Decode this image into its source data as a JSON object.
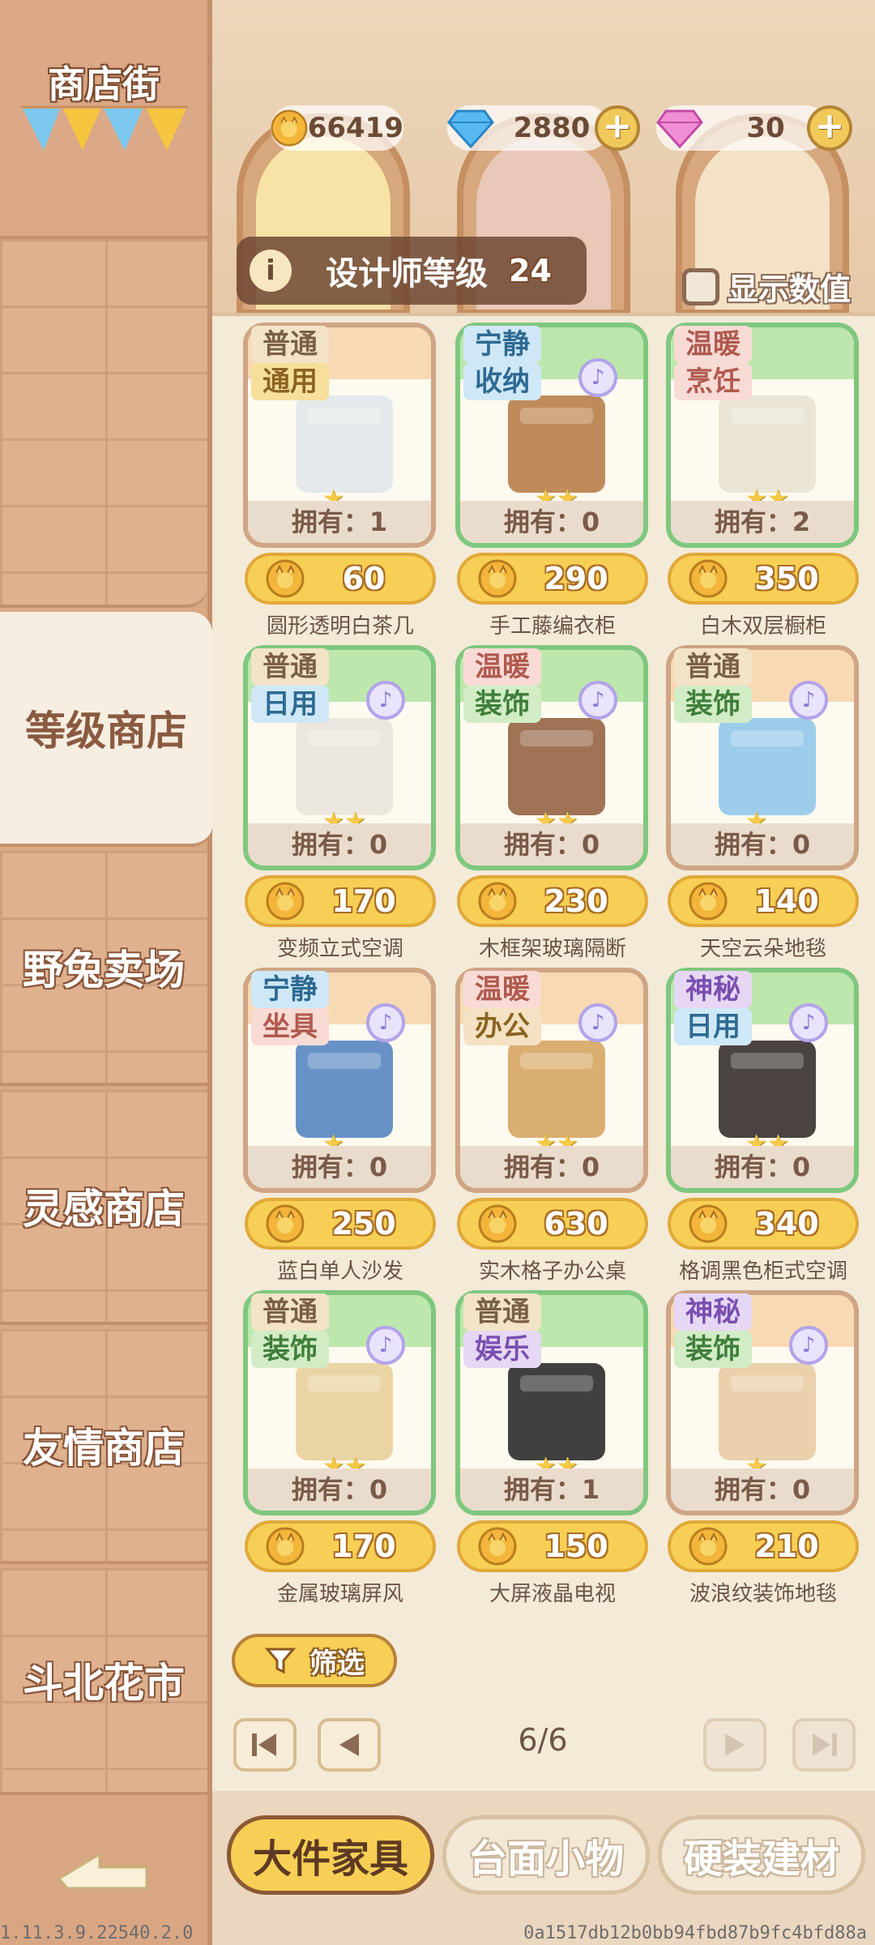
{
  "sidebar": {
    "title": "商店街",
    "tabs": [
      {
        "label": "等级商店"
      },
      {
        "label": "野兔卖场"
      },
      {
        "label": "灵感商店"
      },
      {
        "label": "友情商店"
      },
      {
        "label": "斗北花市"
      }
    ]
  },
  "currencies": {
    "coins": "66419",
    "diamonds": "2880",
    "gems": "30"
  },
  "designer": {
    "label": "设计师等级",
    "level": "24"
  },
  "show_values_label": "显示数值",
  "items": [
    {
      "tag1": "普通",
      "tag2": "通用",
      "owned": "拥有：1",
      "price": "60",
      "name": "圆形透明白茶几",
      "stars": "★"
    },
    {
      "tag1": "宁静",
      "tag2": "收纳",
      "owned": "拥有：0",
      "price": "290",
      "name": "手工藤编衣柜",
      "stars": "★★"
    },
    {
      "tag1": "温暖",
      "tag2": "烹饪",
      "owned": "拥有：2",
      "price": "350",
      "name": "白木双层橱柜",
      "stars": "★★"
    },
    {
      "tag1": "普通",
      "tag2": "日用",
      "owned": "拥有：0",
      "price": "170",
      "name": "变频立式空调",
      "stars": "★★"
    },
    {
      "tag1": "温暖",
      "tag2": "装饰",
      "owned": "拥有：0",
      "price": "230",
      "name": "木框架玻璃隔断",
      "stars": "★★"
    },
    {
      "tag1": "普通",
      "tag2": "装饰",
      "owned": "拥有：0",
      "price": "140",
      "name": "天空云朵地毯",
      "stars": "★"
    },
    {
      "tag1": "宁静",
      "tag2": "坐具",
      "owned": "拥有：0",
      "price": "250",
      "name": "蓝白单人沙发",
      "stars": "★"
    },
    {
      "tag1": "温暖",
      "tag2": "办公",
      "owned": "拥有：0",
      "price": "630",
      "name": "实木格子办公桌",
      "stars": "★★"
    },
    {
      "tag1": "神秘",
      "tag2": "日用",
      "owned": "拥有：0",
      "price": "340",
      "name": "格调黑色柜式空调",
      "stars": "★★"
    },
    {
      "tag1": "普通",
      "tag2": "装饰",
      "owned": "拥有：0",
      "price": "170",
      "name": "金属玻璃屏风",
      "stars": "★★"
    },
    {
      "tag1": "普通",
      "tag2": "娱乐",
      "owned": "拥有：1",
      "price": "150",
      "name": "大屏液晶电视",
      "stars": "★★"
    },
    {
      "tag1": "神秘",
      "tag2": "装饰",
      "owned": "拥有：0",
      "price": "210",
      "name": "波浪纹装饰地毯",
      "stars": "★"
    }
  ],
  "filter_label": "筛选",
  "pager": {
    "text": "6/6"
  },
  "bottom_tabs": [
    {
      "label": "大件家具"
    },
    {
      "label": "台面小物"
    },
    {
      "label": "硬装建材"
    }
  ],
  "footer": {
    "version": "1.11.3.9.22540.2.0",
    "hash": "0a1517db12b0bb94fbd87b9fc4bfd88a"
  },
  "icons": {
    "coin": "cat-coin-icon",
    "diamond": "blue-diamond-icon",
    "gem": "pink-gem-icon",
    "music": "music-note-icon"
  },
  "colors": {
    "accent_yellow": "#f8cf55",
    "card_green": "#7fc77f",
    "card_tan": "#cfa586"
  }
}
